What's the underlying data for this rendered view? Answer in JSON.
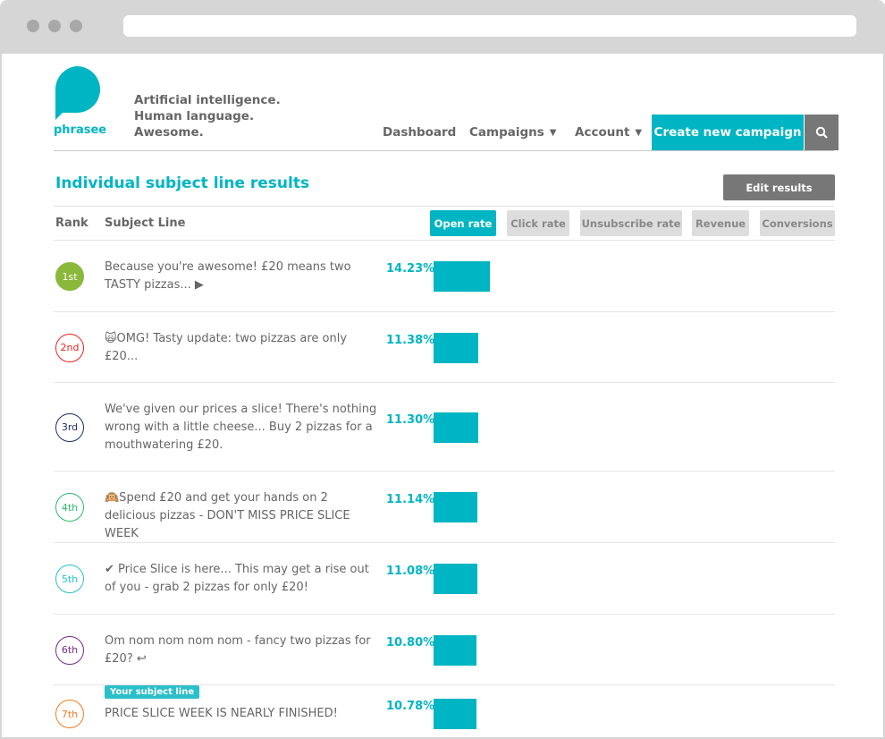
{
  "brand": {
    "name": "phrasee",
    "tagline": [
      "Artificial intelligence.",
      "Human language.",
      "Awesome."
    ],
    "color": "#00b5c3"
  },
  "nav": {
    "dashboard": "Dashboard",
    "campaigns": "Campaigns",
    "account": "Account",
    "create": "Create new campaign"
  },
  "page": {
    "title": "Individual subject line results",
    "edit": "Edit results"
  },
  "table": {
    "rank_header": "Rank",
    "subject_header": "Subject Line",
    "metric_tabs": [
      "Open rate",
      "Click rate",
      "Unsubscribe rate",
      "Revenue",
      "Conversions"
    ],
    "active_tab": "Open rate"
  },
  "rows": [
    {
      "rank": "1st",
      "color": "#8ab83a",
      "filled": true,
      "subject": "Because you're awesome! £20 means two TASTY pizzas... ▶",
      "value": "14.23%",
      "pct": 14.23
    },
    {
      "rank": "2nd",
      "color": "#ee2222",
      "subject": "🙀OMG! Tasty update: two pizzas are only £20...",
      "value": "11.38%",
      "pct": 11.38
    },
    {
      "rank": "3rd",
      "color": "#1e2a6a",
      "subject": "We've given our prices a slice! There's nothing wrong with a little cheese... Buy 2 pizzas for a mouthwatering £20.",
      "value": "11.30%",
      "pct": 11.3
    },
    {
      "rank": "4th",
      "color": "#2dba6e",
      "subject": "🙉Spend £20 and get your hands on 2 delicious pizzas - DON'T MISS PRICE SLICE WEEK",
      "value": "11.14%",
      "pct": 11.14
    },
    {
      "rank": "5th",
      "color": "#1fc3cf",
      "subject": "✔ Price Slice is here... This may get a rise out of you - grab 2 pizzas for only £20!",
      "value": "11.08%",
      "pct": 11.08
    },
    {
      "rank": "6th",
      "color": "#7a2a8a",
      "subject": "Om nom nom nom nom - fancy two pizzas for £20? ↩",
      "value": "10.80%",
      "pct": 10.8
    },
    {
      "rank": "7th",
      "color": "#f47a22",
      "subject": "PRICE SLICE WEEK IS NEARLY FINISHED!",
      "value": "10.78%",
      "pct": 10.78,
      "badge": "Your subject line"
    }
  ]
}
